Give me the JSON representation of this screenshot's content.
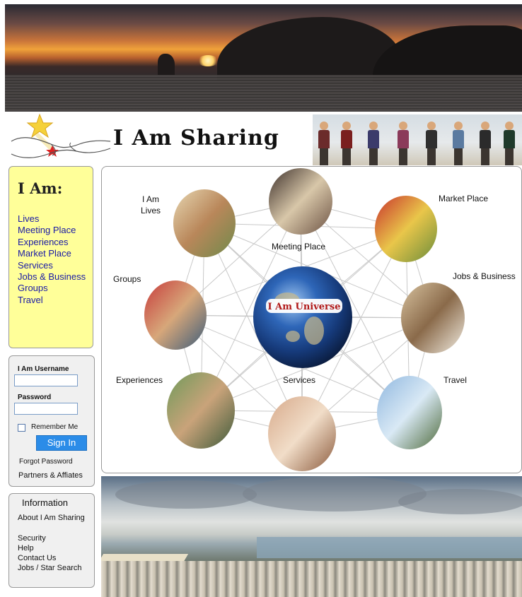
{
  "site": {
    "title": "I Am Sharing"
  },
  "nav": {
    "heading": "I Am:",
    "links": [
      "Lives",
      "Meeting Place",
      "Experiences",
      "Market Place",
      "Services",
      "Jobs & Business",
      "Groups",
      "Travel"
    ]
  },
  "login": {
    "username_label": "I Am Username",
    "username_value": "",
    "password_label": "Password",
    "password_value": "",
    "remember_label": "Remember Me",
    "signin_label": "Sign In",
    "forgot_label": "Forgot Password",
    "partners_label": "Partners & Affiates"
  },
  "info": {
    "heading": "Information",
    "links": [
      "About I Am Sharing",
      "Security",
      "Help",
      "Contact Us",
      "Jobs / Star Search"
    ]
  },
  "network": {
    "center_label": "I Am Universe",
    "nodes": [
      {
        "id": "lives",
        "label": "I Am\nLives",
        "label_line1": "I Am",
        "label_line2": "Lives",
        "colors": [
          "#e7d7b2",
          "#b9875a",
          "#6f8a4b"
        ]
      },
      {
        "id": "meeting",
        "label": "Meeting Place",
        "colors": [
          "#3c2f2a",
          "#d8c7a9",
          "#6b5142"
        ]
      },
      {
        "id": "market",
        "label": "Market Place",
        "colors": [
          "#c8322d",
          "#e9c64a",
          "#6a8c3b"
        ]
      },
      {
        "id": "groups",
        "label": "Groups",
        "colors": [
          "#c73b3b",
          "#d7a77a",
          "#3a5b7a"
        ]
      },
      {
        "id": "jobs",
        "label": "Jobs & Business",
        "colors": [
          "#d8c3a0",
          "#8a6a4a",
          "#f2ede2"
        ]
      },
      {
        "id": "experiences",
        "label": "Experiences",
        "colors": [
          "#6f9a5a",
          "#c9a37a",
          "#3d5a3a"
        ]
      },
      {
        "id": "services",
        "label": "Services",
        "colors": [
          "#d7a98a",
          "#f1ddc8",
          "#8b5a3c"
        ]
      },
      {
        "id": "travel",
        "label": "Travel",
        "colors": [
          "#8fb7df",
          "#d9e9f5",
          "#4e6a3b"
        ]
      }
    ]
  }
}
